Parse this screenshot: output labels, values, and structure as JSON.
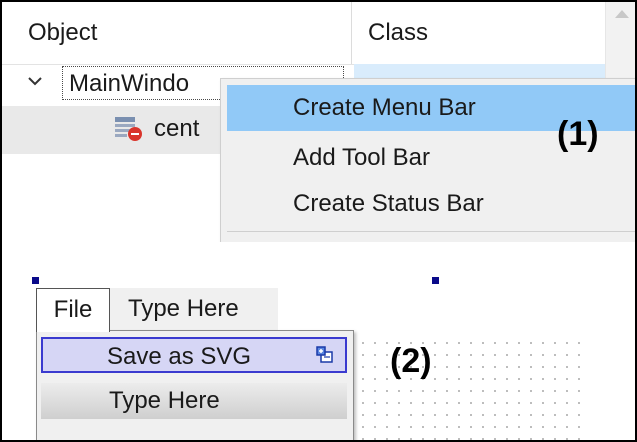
{
  "inspector": {
    "columns": {
      "object": "Object",
      "class": "Class"
    },
    "tree": {
      "main_label": "MainWindo",
      "child_label": "cent"
    }
  },
  "context_menu": {
    "items": [
      {
        "label": "Create Menu Bar",
        "highlighted": true
      },
      {
        "label": "Add Tool Bar",
        "highlighted": false
      },
      {
        "label": "Create Status Bar",
        "highlighted": false
      }
    ]
  },
  "form_editor": {
    "menubar": {
      "items": [
        "File",
        "Type Here"
      ]
    },
    "dropdown": {
      "items": [
        "Save as SVG",
        "Type Here"
      ]
    }
  },
  "annotations": {
    "step1": "(1)",
    "step2": "(2)"
  },
  "colors": {
    "menu_highlight": "#91c9f7",
    "tree_selection": "#d9ecfc",
    "dropdown_selection": "#d6d6f5",
    "dropdown_selection_border": "#3a3acf",
    "selection_handle": "#0a0a8a"
  },
  "icons": {
    "tree_expand": "chevron-down-icon",
    "child_widget": "widget-icon",
    "add_submenu": "add-submenu-icon"
  }
}
